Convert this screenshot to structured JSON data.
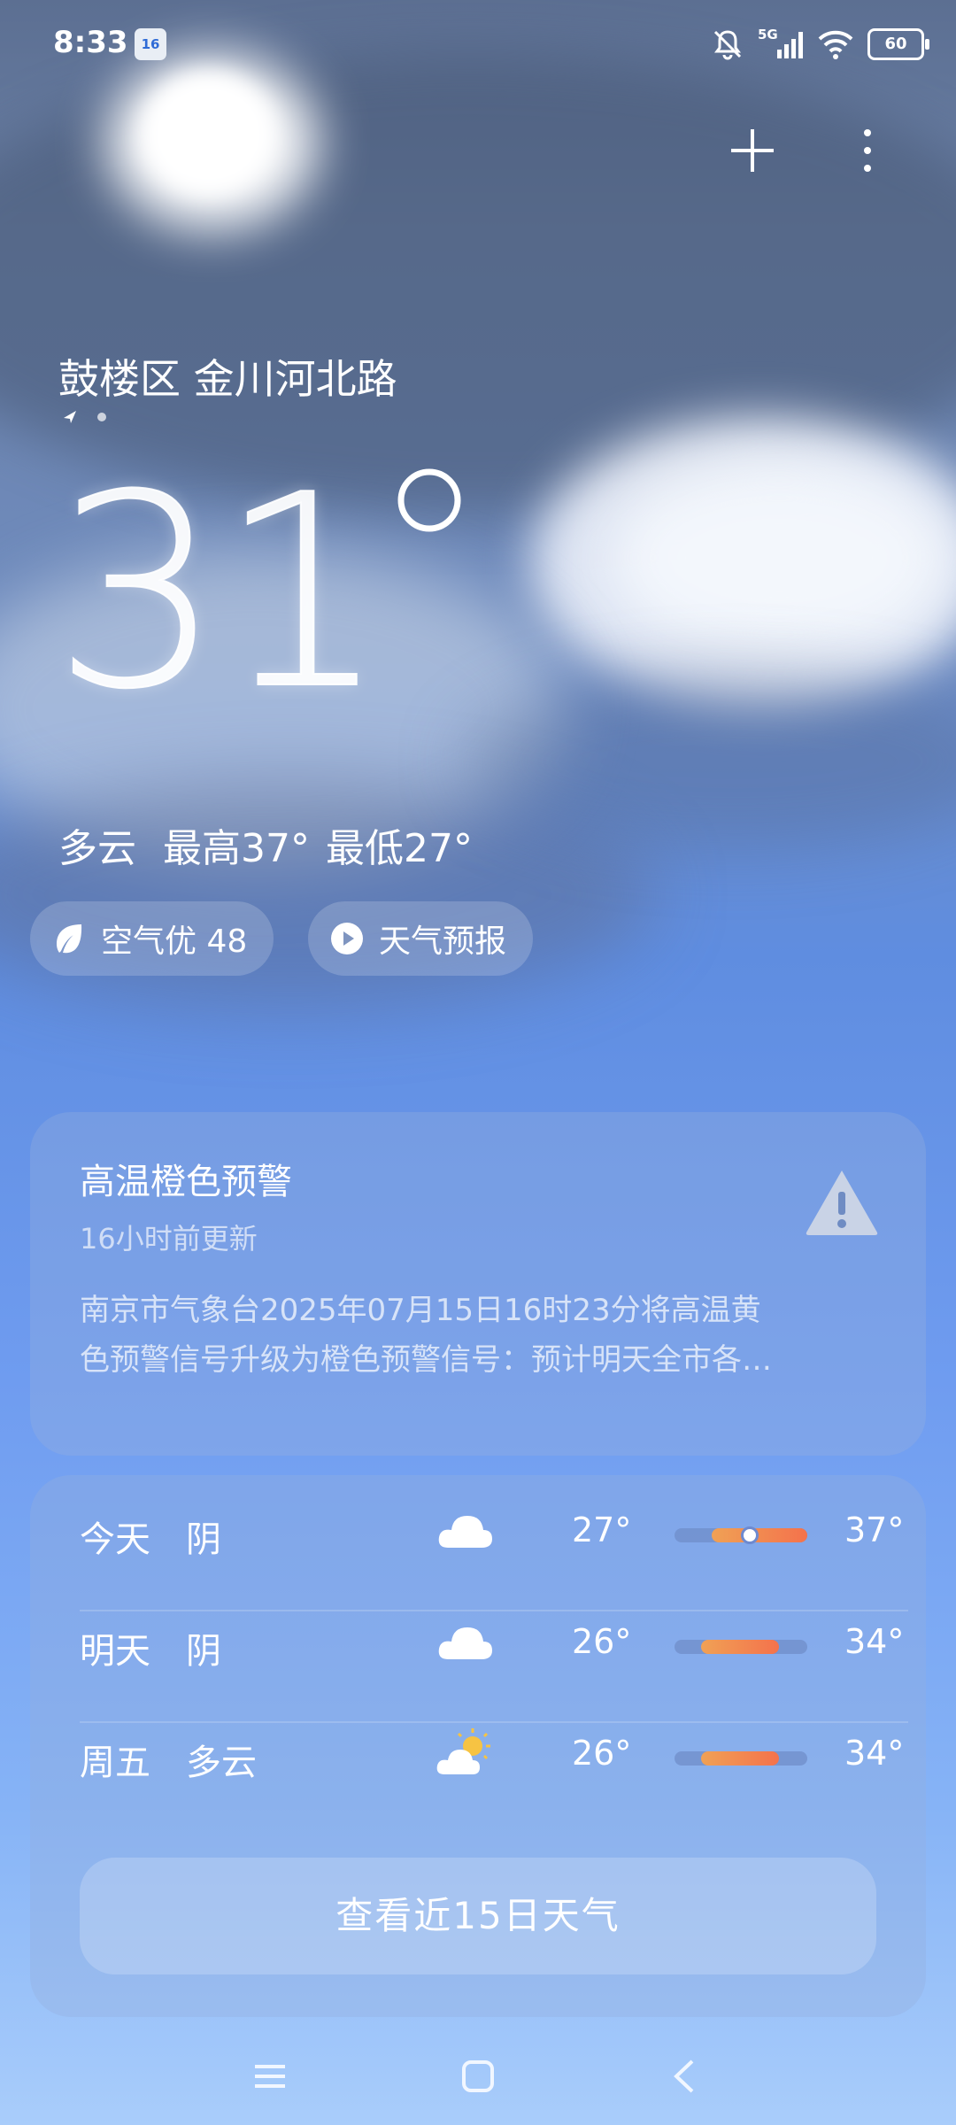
{
  "status_bar": {
    "time": "8:33",
    "notification_badge": "16",
    "network": "5G",
    "battery": "60"
  },
  "header": {
    "add_icon": "plus-icon",
    "menu_icon": "more-vertical-icon"
  },
  "location": {
    "name": "鼓楼区 金川河北路"
  },
  "current": {
    "temperature": "31",
    "condition": "多云",
    "high": "最高37°",
    "low": "最低27°"
  },
  "chips": {
    "air_quality": "空气优 48",
    "forecast_video": "天气预报"
  },
  "alert": {
    "title": "高温橙色预警",
    "updated": "16小时前更新",
    "line1": "南京市气象台2025年07月15日16时23分将高温黄",
    "line2": "色预警信号升级为橙色预警信号：预计明天全市各…"
  },
  "forecast": {
    "days": [
      {
        "day": "今天",
        "condition": "阴",
        "icon": "cloud-icon",
        "low": "27°",
        "high": "37°"
      },
      {
        "day": "明天",
        "condition": "阴",
        "icon": "cloud-icon",
        "low": "26°",
        "high": "34°"
      },
      {
        "day": "周五",
        "condition": "多云",
        "icon": "partly-cloudy-icon",
        "low": "26°",
        "high": "34°"
      }
    ],
    "more_button": "查看近15日天气"
  },
  "colors": {
    "accent_orange": "#f4724c",
    "warning_icon": "#c9d3e6"
  }
}
